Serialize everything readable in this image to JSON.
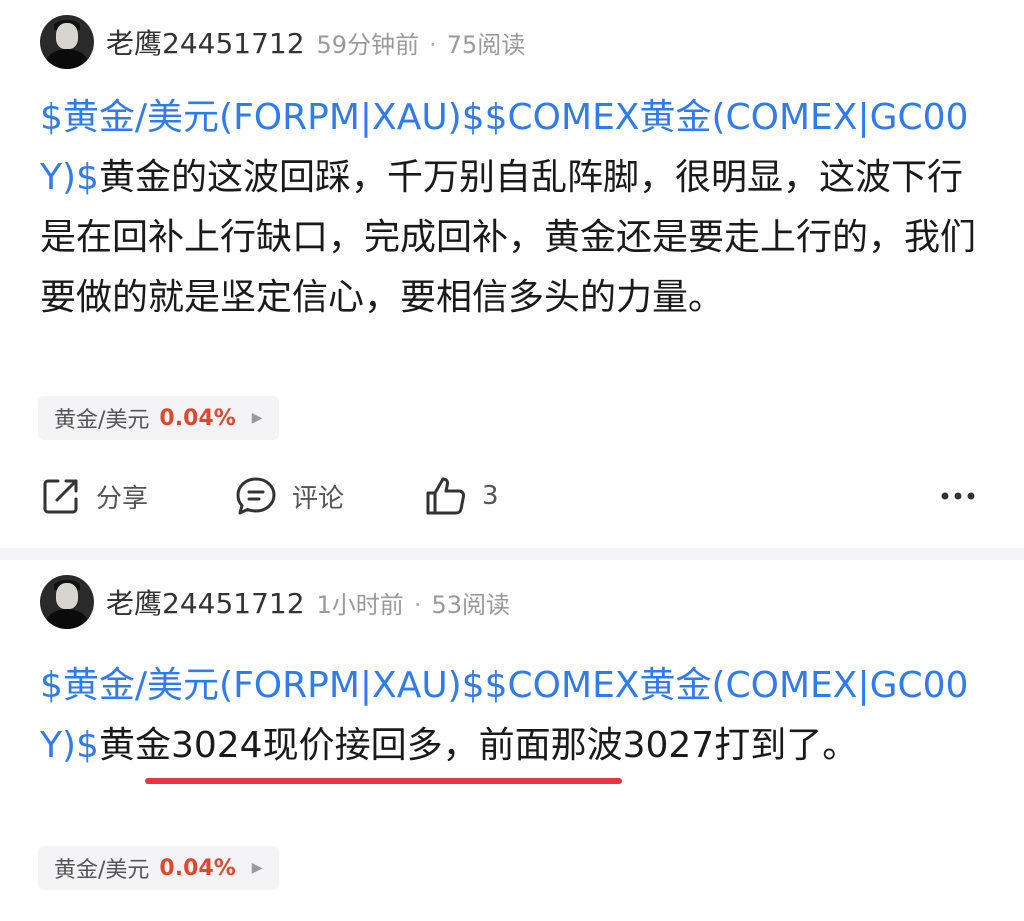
{
  "posts": [
    {
      "author": "老鹰24451712",
      "time_ago": "59分钟前",
      "reads": "75阅读",
      "separator": "·",
      "tags": [
        "$黄金/美元(FORPM|XAU)$",
        "$COMEX黄金(COMEX|GC00Y)$"
      ],
      "text": "黄金的这波回踩，千万别自乱阵脚，很明显，这波下行是在回补上行缺口，完成回补，黄金还是要走上行的，我们要做的就是坚定信心，要相信多头的力量。",
      "stock": {
        "name": "黄金/美元",
        "change": "0.04%",
        "arrow": "▶"
      },
      "actions": {
        "share": "分享",
        "comment": "评论",
        "like_count": "3"
      }
    },
    {
      "author": "老鹰24451712",
      "time_ago": "1小时前",
      "reads": "53阅读",
      "separator": "·",
      "tags": [
        "$黄金/美元(FORPM|XAU)$",
        "$COMEX黄金(COMEX|GC00Y)$"
      ],
      "text": "黄金3024现价接回多，前面那波3027打到了。",
      "stock": {
        "name": "黄金/美元",
        "change": "0.04%",
        "arrow": "▶"
      }
    }
  ],
  "colors": {
    "link": "#2f7bf1",
    "up": "#e0472f",
    "underline": "#e8363a"
  }
}
